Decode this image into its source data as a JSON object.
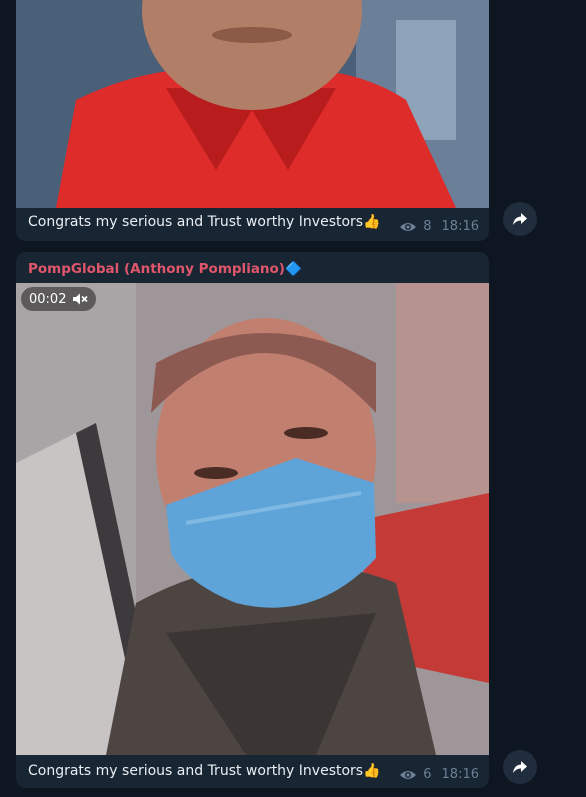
{
  "messages": [
    {
      "caption": "Congrats my serious and Trust worthy Investors👍",
      "views": "8",
      "time": "18:16"
    },
    {
      "sender": "PompGlobal (Anthony Pompliano)🔷",
      "video_time": "00:02",
      "caption": "Congrats my serious and Trust worthy Investors👍",
      "views": "6",
      "time": "18:16"
    }
  ],
  "icons": {
    "views": "eye-icon",
    "share": "share-arrow-icon",
    "muted": "speaker-muted-icon"
  },
  "colors": {
    "background": "#0e1621",
    "bubble": "#182533",
    "sender_name": "#e0566b",
    "meta_text": "#6d8095"
  }
}
